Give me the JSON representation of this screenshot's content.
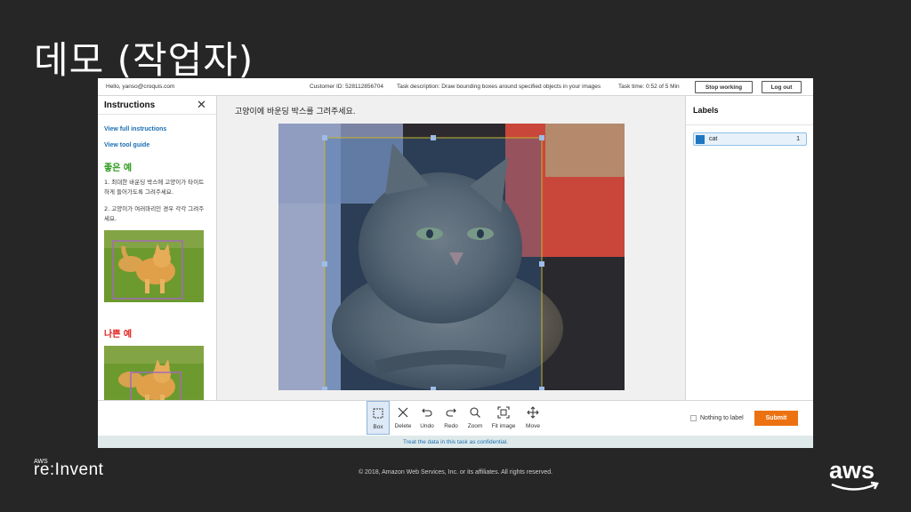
{
  "slide": {
    "title": "데모 (작업자)",
    "copyright": "© 2018, Amazon Web Services, Inc. or its affiliates. All rights reserved.",
    "event_logo_small": "AWS",
    "event_logo": "re:Invent",
    "aws_logo_text": "aws"
  },
  "topbar": {
    "greeting": "Hello, yanso@croquis.com",
    "customer_id": "Customer ID: 528112856704",
    "task_description": "Task description: Draw bounding boxes around specified objects in your images",
    "task_time": "Task time: 0:52 of 5 Min",
    "stop_label": "Stop working",
    "logout_label": "Log out"
  },
  "instructions": {
    "header": "Instructions",
    "close_icon": "close-icon",
    "full_link": "View full instructions",
    "tool_link": "View tool guide",
    "good_heading": "좋은 예",
    "good_line1": "1. 최대한 바운딩 박스에 고양이가 타이트하게 들어가도록 그려주세요.",
    "good_line2": "2. 고양이가 여러마리인 경우 각각 그려주세요.",
    "bad_heading": "나쁜 예"
  },
  "main": {
    "task_text": "고양이에 바운딩 박스를 그려주세요."
  },
  "labels": {
    "header": "Labels",
    "items": [
      {
        "name": "cat",
        "key": "1",
        "color": "#1f77c0"
      }
    ]
  },
  "toolbar": {
    "tools": [
      {
        "label": "Box",
        "icon": "box-icon"
      },
      {
        "label": "Delete",
        "icon": "delete-icon"
      },
      {
        "label": "Undo",
        "icon": "undo-icon"
      },
      {
        "label": "Redo",
        "icon": "redo-icon"
      },
      {
        "label": "Zoom",
        "icon": "zoom-icon"
      },
      {
        "label": "Fit image",
        "icon": "fit-image-icon"
      },
      {
        "label": "Move",
        "icon": "move-icon"
      }
    ],
    "nothing_label": "Nothing to label",
    "submit_label": "Submit"
  },
  "footer": {
    "confidential": "Treat the data in this task as confidential."
  },
  "colors": {
    "background": "#262626",
    "accent": "#ec7211",
    "link": "#1a6fb5",
    "bbox": "#c9b52a",
    "good": "#2a9a1a",
    "bad": "#e0201a"
  }
}
